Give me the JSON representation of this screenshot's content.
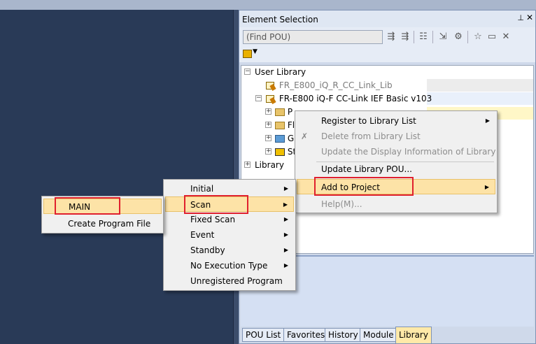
{
  "panel": {
    "title": "Element Selection",
    "pin": "⊥",
    "close": "✕",
    "search_placeholder": "(Find POU)"
  },
  "toolbar_icons": [
    "find-next-icon",
    "find-prev-icon",
    "list-icon",
    "import-icon",
    "settings-icon",
    "favorite-icon",
    "folder-icon",
    "delete-icon"
  ],
  "tree": {
    "user_library": "User Library",
    "lib1": "FR_E800_iQ_R_CC_Link_Lib",
    "lib2": "FR-E800 iQ-F CC-Link IEF Basic v103",
    "child1": "P",
    "child2": "Fl",
    "child3": "G",
    "child4": "St",
    "library": "Library"
  },
  "tabs": [
    "POU List",
    "Favorites",
    "History",
    "Module",
    "Library"
  ],
  "library_menu": {
    "items": [
      {
        "label": "Register to Library List",
        "submenu": true,
        "disabled": false
      },
      {
        "label": "Delete from Library List",
        "submenu": false,
        "disabled": true
      },
      {
        "label": "Update the Display Information of Library",
        "submenu": false,
        "disabled": true
      },
      {
        "label": "Update Library POU...",
        "submenu": false,
        "disabled": false
      },
      {
        "label": "Add to Project",
        "submenu": true,
        "disabled": false
      },
      {
        "label": "Help(M)...",
        "submenu": false,
        "disabled": true
      }
    ]
  },
  "program_type_menu": {
    "items": [
      "Initial",
      "Scan",
      "Fixed Scan",
      "Event",
      "Standby",
      "No Execution Type",
      "Unregistered Program"
    ]
  },
  "program_menu": {
    "items": [
      "MAIN",
      "Create Program File"
    ]
  }
}
